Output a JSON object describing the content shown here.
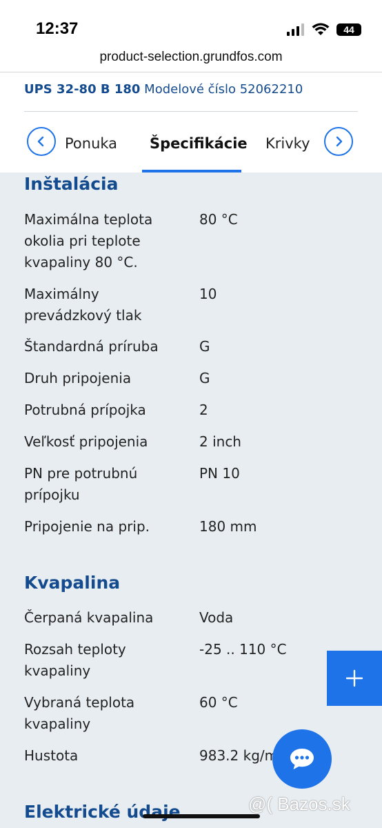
{
  "status_bar": {
    "time": "12:37",
    "battery": "44"
  },
  "browser": {
    "url": "product-selection.grundfos.com"
  },
  "product": {
    "model": "UPS 32-80 B 180",
    "model_number_label": "Modelové číslo",
    "model_number": "52062210"
  },
  "tabs": {
    "menu": "Ponuka",
    "specifications": "Špecifikácie",
    "curves": "Krivky"
  },
  "sections": [
    {
      "title": "Inštalácia",
      "rows": [
        {
          "label": "Maximálna teplota okolia pri teplote kvapaliny 80 °C.",
          "value": "80 °C"
        },
        {
          "label": "Maximálny prevádzkový tlak",
          "value": "10"
        },
        {
          "label": "Štandardná príruba",
          "value": "G"
        },
        {
          "label": "Druh pripojenia",
          "value": "G"
        },
        {
          "label": "Potrubná prípojka",
          "value": "2"
        },
        {
          "label": "Veľkosť pripojenia",
          "value": "2 inch"
        },
        {
          "label": "PN pre potrubnú prípojku",
          "value": "PN 10"
        },
        {
          "label": "Pripojenie na prip.",
          "value": "180 mm"
        }
      ]
    },
    {
      "title": "Kvapalina",
      "rows": [
        {
          "label": "Čerpaná kvapalina",
          "value": "Voda"
        },
        {
          "label": "Rozsah teploty kvapaliny",
          "value": "-25 .. 110 °C"
        },
        {
          "label": "Vybraná teplota kvapaliny",
          "value": "60 °C"
        },
        {
          "label": "Hustota",
          "value": "983.2 kg/m"
        }
      ]
    },
    {
      "title": "Elektrické údaje",
      "rows": []
    }
  ],
  "watermark": "@( Bazos.sk",
  "colors": {
    "accent": "#1e73e8",
    "heading": "#144b8e",
    "background": "#e8edf1"
  }
}
